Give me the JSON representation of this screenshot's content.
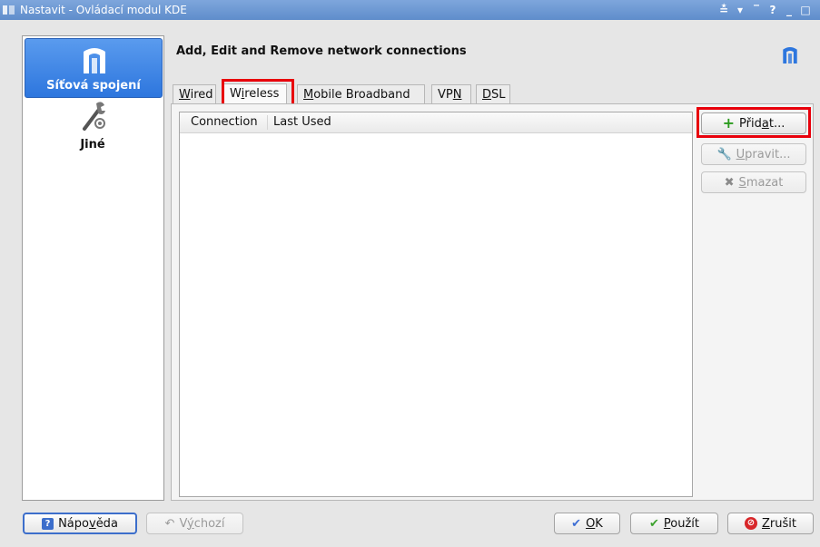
{
  "window": {
    "title": "Nastavit - Ovládací modul KDE",
    "controls": [
      "≛",
      "▾",
      "‾",
      "?",
      "_",
      "□"
    ]
  },
  "sidebar": {
    "items": [
      {
        "label": "Síťová spojení",
        "icon": "network-manager-icon",
        "selected": true
      },
      {
        "label": "Jiné",
        "icon": "tools-icon",
        "selected": false
      }
    ]
  },
  "header": {
    "title": "Add, Edit and Remove network connections"
  },
  "tabs": [
    {
      "pre": "",
      "mn": "W",
      "post": "ired",
      "active": false
    },
    {
      "pre": "W",
      "mn": "i",
      "post": "reless",
      "active": true
    },
    {
      "pre": "",
      "mn": "M",
      "post": "obile Broadband",
      "active": false
    },
    {
      "pre": "VP",
      "mn": "N",
      "post": "",
      "active": false
    },
    {
      "pre": "",
      "mn": "D",
      "post": "SL",
      "active": false
    }
  ],
  "connections_list": {
    "columns": [
      "Connection",
      "Last Used"
    ],
    "rows": []
  },
  "side_buttons": {
    "add": {
      "pre": "Přid",
      "mn": "a",
      "post": "t...",
      "enabled": true
    },
    "edit": {
      "pre": "",
      "mn": "U",
      "post": "pravit...",
      "enabled": false
    },
    "delete": {
      "pre": "",
      "mn": "S",
      "post": "mazat",
      "enabled": false
    }
  },
  "footer": {
    "help": {
      "pre": "Nápo",
      "mn": "v",
      "post": "ěda"
    },
    "defaults": {
      "pre": "V",
      "mn": "ý",
      "post": "chozí",
      "enabled": false
    },
    "ok": {
      "pre": "",
      "mn": "O",
      "post": "K"
    },
    "apply": {
      "pre": "",
      "mn": "P",
      "post": "oužít"
    },
    "cancel": {
      "pre": "",
      "mn": "Z",
      "post": "rušit"
    }
  },
  "colors": {
    "highlight": "#e8000b",
    "selection": "#2d76de",
    "add_icon": "#2a9a1d",
    "cancel_icon": "#d8272a"
  }
}
